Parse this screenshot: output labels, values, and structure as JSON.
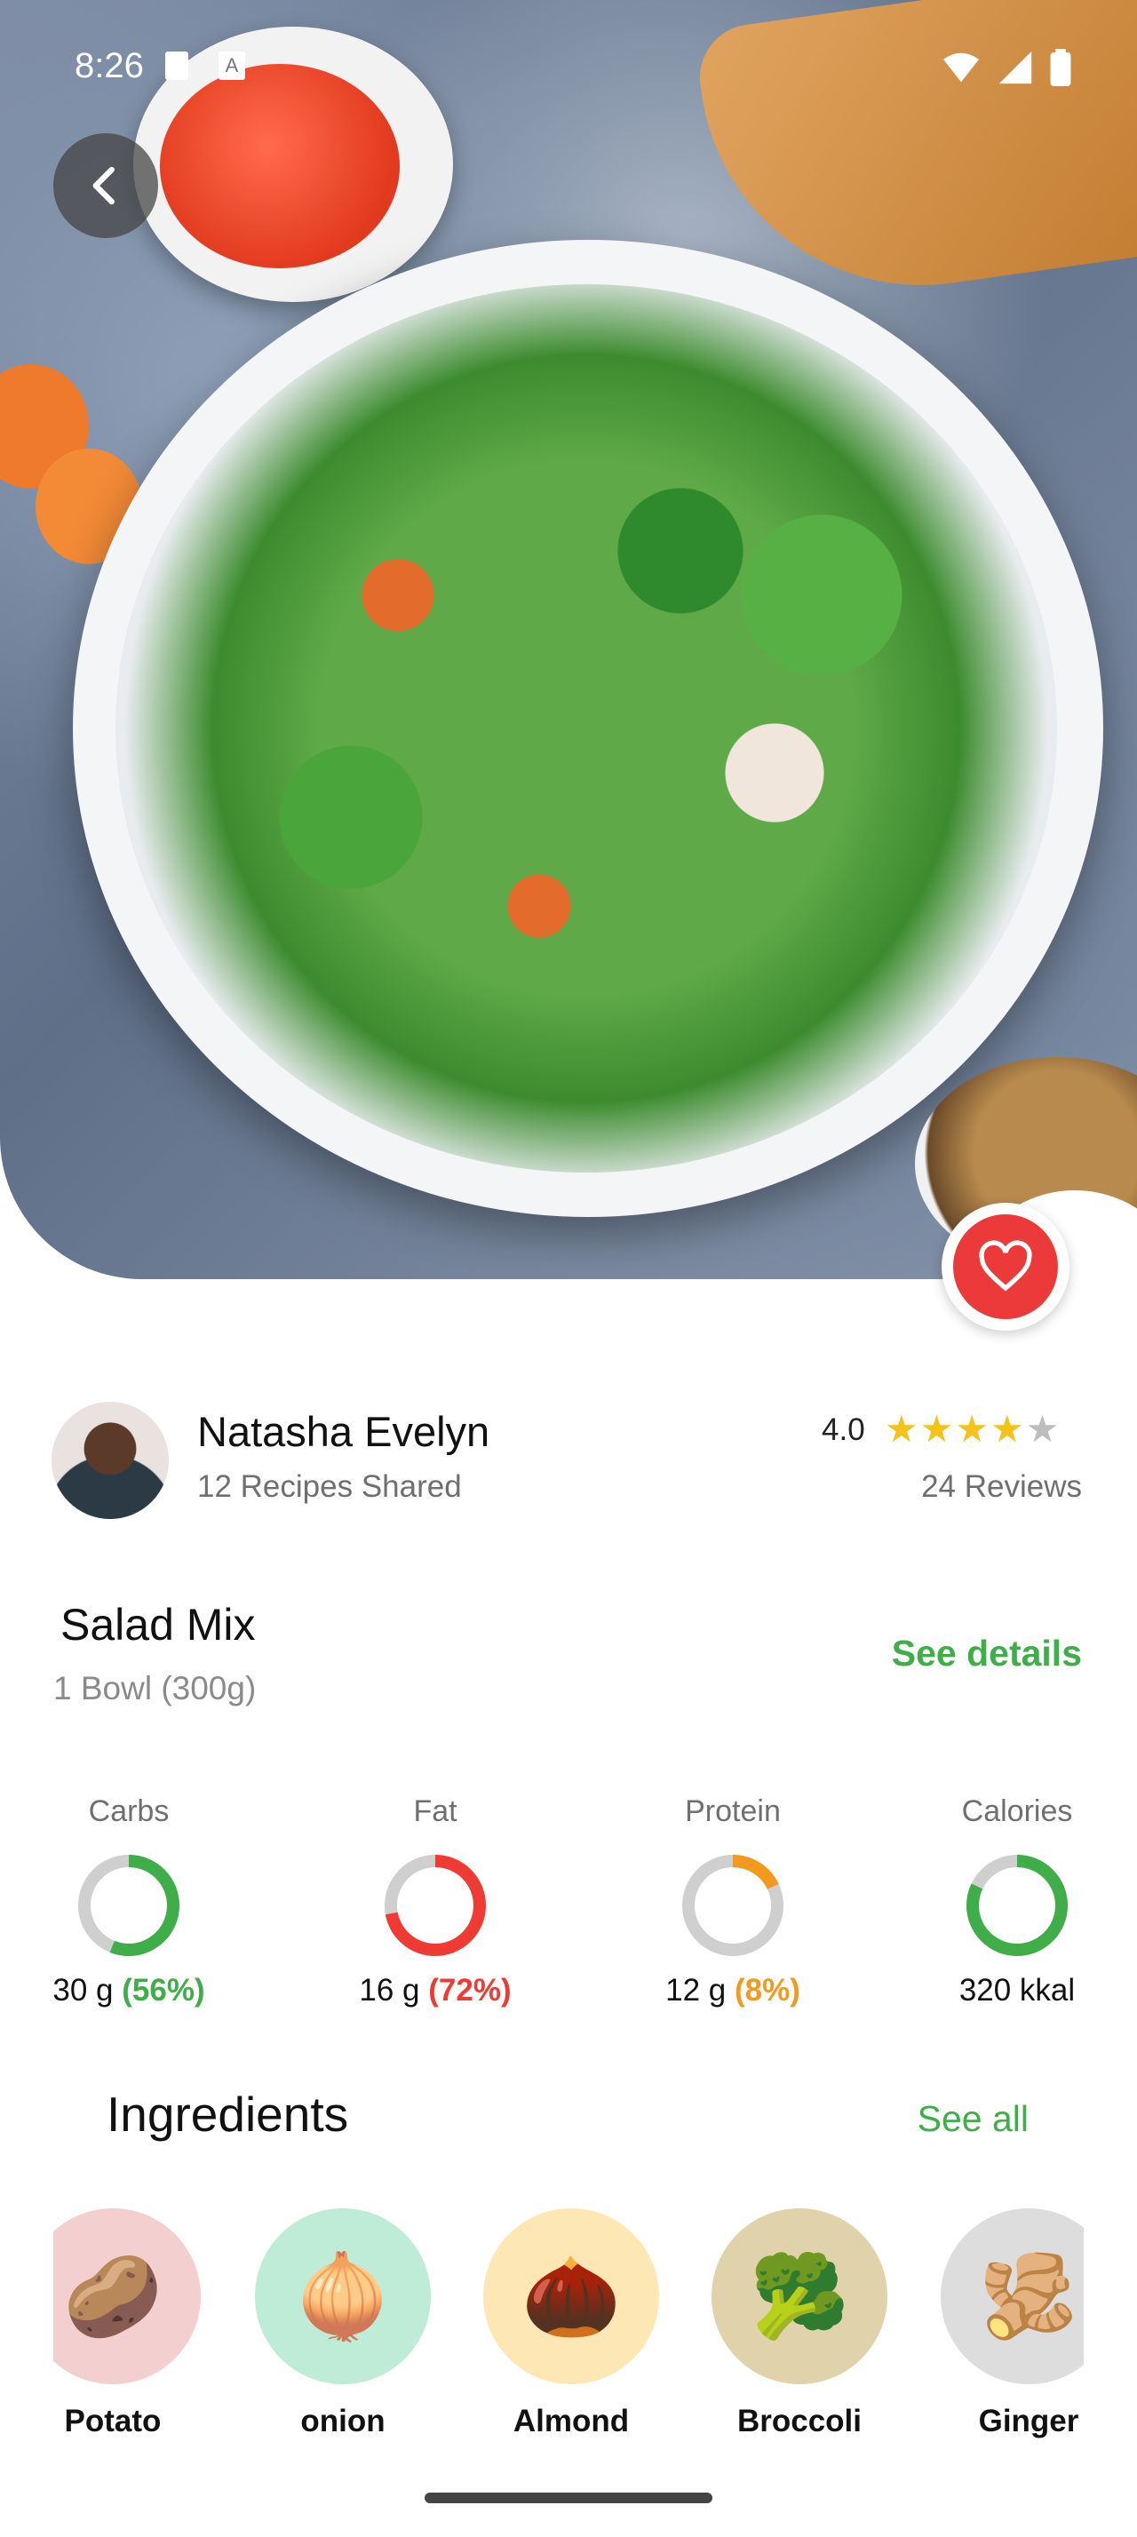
{
  "status_bar": {
    "time": "8:26",
    "a_icon": "A",
    "icons": [
      "wifi-icon",
      "signal-icon",
      "battery-icon"
    ]
  },
  "author": {
    "name": "Natasha Evelyn",
    "subtitle": "12 Recipes Shared",
    "rating": "4.0",
    "stars": 4,
    "star_max": 5,
    "reviews": "24 Reviews"
  },
  "dish": {
    "title": "Salad Mix",
    "portion": "1 Bowl (300g)",
    "see_details": "See details"
  },
  "nutrients": [
    {
      "label": "Carbs",
      "amount": "30 g ",
      "percent": "(56%)",
      "fill": 0.56,
      "color": "#3fae49"
    },
    {
      "label": "Fat",
      "amount": "16 g ",
      "percent": "(72%)",
      "fill": 0.72,
      "color": "#ef3b34"
    },
    {
      "label": "Protein",
      "amount": "12 g ",
      "percent": "(8%)",
      "fill": 0.18,
      "color": "#f39a1e"
    },
    {
      "label": "Calories",
      "amount": "320 kkal",
      "percent": "",
      "fill": 0.82,
      "color": "#3fae49"
    }
  ],
  "ingredients": {
    "title": "Ingredients",
    "see_all": "See all",
    "items": [
      {
        "name": "Potato",
        "bg": "#f4cfcf",
        "icon": "🥔"
      },
      {
        "name": "onion",
        "bg": "#bfecd6",
        "icon": "🧅"
      },
      {
        "name": "Almond",
        "bg": "#fde8b5",
        "icon": "🌰"
      },
      {
        "name": "Broccoli",
        "bg": "#e0d3ab",
        "icon": "🥦"
      },
      {
        "name": "Ginger",
        "bg": "#dddddd",
        "icon": "🫚"
      }
    ]
  },
  "colors": {
    "accent": "#3fae49",
    "favorite": "#ec3a3a",
    "star": "#f5c21b"
  }
}
